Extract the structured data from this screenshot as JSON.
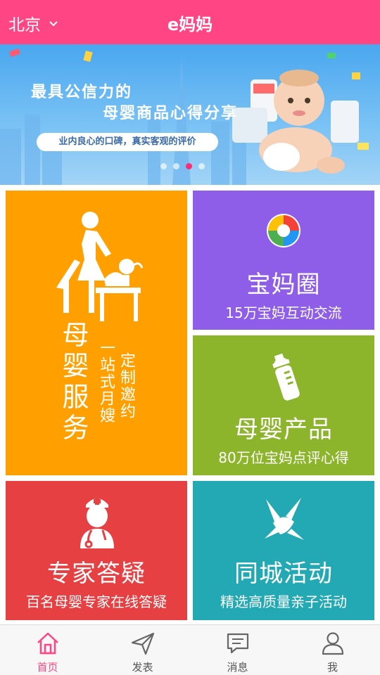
{
  "header": {
    "city": "北京",
    "title": "e妈妈"
  },
  "banner": {
    "line1": "最具公信力的",
    "line2": "母婴商品心得分享",
    "sub": "业内良心的口碑，真实客观的评价",
    "dots": 4,
    "active_dot": 3
  },
  "tiles": {
    "service": {
      "title": "母婴服务",
      "sub1": "一站式月嫂",
      "sub2": "定制邀约"
    },
    "circle": {
      "title": "宝妈圈",
      "sub": "15万宝妈互动交流"
    },
    "product": {
      "title": "母婴产品",
      "sub": "80万位宝妈点评心得"
    },
    "expert": {
      "title": "专家答疑",
      "sub": "百名母婴专家在线答疑"
    },
    "activity": {
      "title": "同城活动",
      "sub": "精选高质量亲子活动"
    }
  },
  "tabs": [
    {
      "label": "首页",
      "icon": "home-icon",
      "active": true
    },
    {
      "label": "发表",
      "icon": "send-icon",
      "active": false
    },
    {
      "label": "消息",
      "icon": "message-icon",
      "active": false
    },
    {
      "label": "我",
      "icon": "user-icon",
      "active": false
    }
  ],
  "colors": {
    "brand": "#ff4584",
    "service": "#ffa000",
    "circle": "#8e5ee8",
    "product": "#8cb52c",
    "expert": "#e64043",
    "activity": "#22a9b4"
  }
}
